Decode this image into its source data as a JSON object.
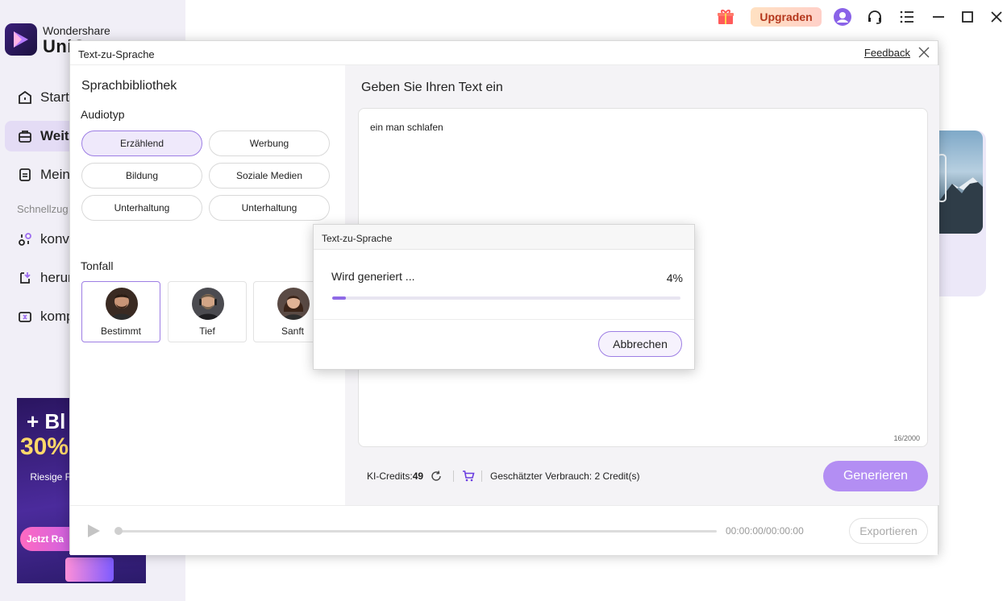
{
  "app": {
    "brand_top": "Wondershare",
    "brand_name": "UniC",
    "nav": [
      {
        "label": "Starts",
        "icon": "home-icon",
        "active": false
      },
      {
        "label": "Weit",
        "icon": "toolbox-icon",
        "active": true
      },
      {
        "label": "Meine",
        "icon": "document-icon",
        "active": false
      }
    ],
    "section_label": "Schnellzug",
    "quick": [
      {
        "label": "konv",
        "icon": "convert-icon"
      },
      {
        "label": "herun",
        "icon": "download-icon"
      },
      {
        "label": "komp",
        "icon": "compress-icon"
      }
    ],
    "promo": {
      "line1": "+ Bl",
      "line2": "30%",
      "text": "Riesige F Black Frid veröf UniC",
      "cta": "Jetzt Ra"
    },
    "topbar": {
      "upgrade_label": "Upgraden"
    }
  },
  "dialog": {
    "title": "Text-zu-Sprache",
    "feedback_label": "Feedback",
    "library_title": "Sprachbibliothek",
    "audiotype_label": "Audiotyp",
    "audiotypes": [
      {
        "label": "Erzählend",
        "selected": true
      },
      {
        "label": "Werbung",
        "selected": false
      },
      {
        "label": "Bildung",
        "selected": false
      },
      {
        "label": "Soziale Medien",
        "selected": false
      },
      {
        "label": "Unterhaltung",
        "selected": false
      },
      {
        "label": "Unterhaltung",
        "selected": false
      }
    ],
    "tone_label": "Tonfall",
    "voices": [
      {
        "label": "Bestimmt",
        "selected": true
      },
      {
        "label": "Tief",
        "selected": false
      },
      {
        "label": "Sanft",
        "selected": false
      }
    ],
    "input_title": "Geben Sie Ihren Text ein",
    "input_text": "ein man schlafen",
    "char_count": "16/2000",
    "credits_label": "KI-Credits:",
    "credits_value": "49",
    "estimated": "Geschätzter Verbrauch: 2 Credit(s)",
    "generate_label": "Generieren",
    "time": "00:00:00/00:00:00",
    "export_label": "Exportieren"
  },
  "progress": {
    "title": "Text-zu-Sprache",
    "status": "Wird generiert ...",
    "percent_label": "4%",
    "percent_value": 4,
    "cancel_label": "Abbrechen"
  },
  "colors": {
    "accent": "#8f6ae6",
    "accent_light": "#b38ef3",
    "upgrade_text": "#b4371c"
  }
}
